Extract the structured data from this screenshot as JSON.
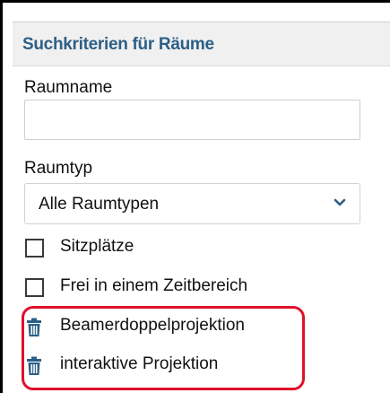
{
  "panel": {
    "title": "Suchkriterien für Räume"
  },
  "raumname": {
    "label": "Raumname",
    "value": "",
    "placeholder": ""
  },
  "raumtyp": {
    "label": "Raumtyp",
    "selected": "Alle Raumtypen"
  },
  "filters": [
    {
      "label": "Sitzplätze",
      "checked": false
    },
    {
      "label": "Frei in einem Zeitbereich",
      "checked": false
    }
  ],
  "equipment_tags": [
    {
      "label": "Beamerdoppelprojektion",
      "icon": "trash-icon"
    },
    {
      "label": "interaktive Projektion",
      "icon": "trash-icon"
    }
  ],
  "colors": {
    "title": "#2d5f86",
    "highlight": "#e0102a",
    "icon": "#2d5f86"
  }
}
